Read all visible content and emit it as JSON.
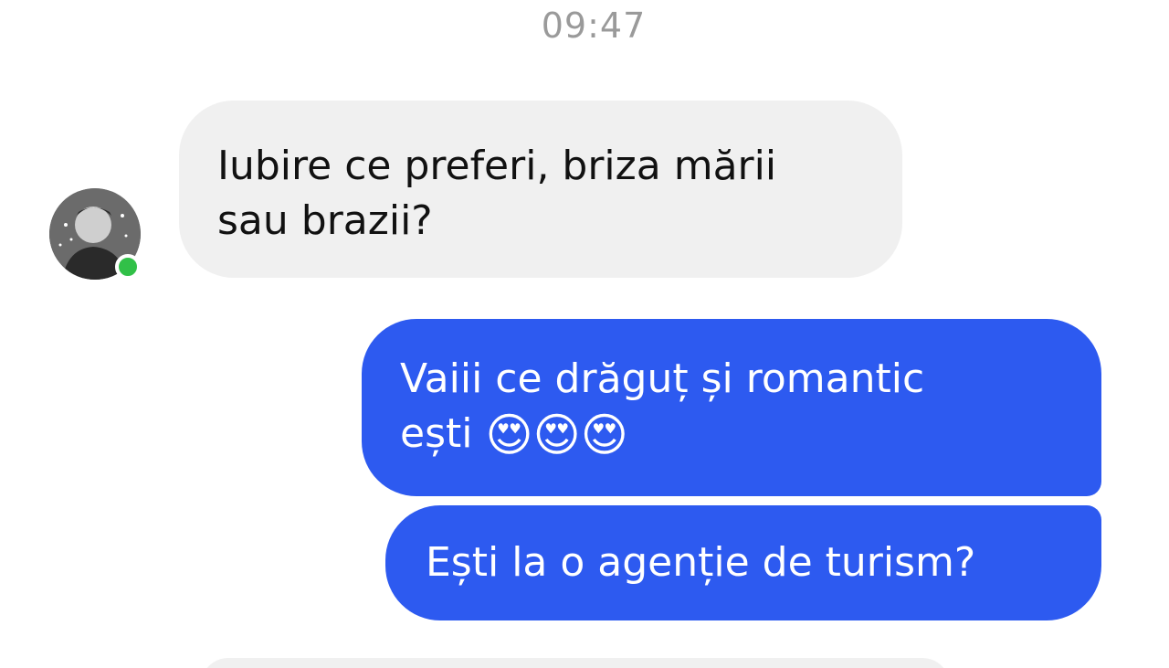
{
  "header": {
    "timestamp": "09:47"
  },
  "contact": {
    "avatar_icon": "person-avatar",
    "online_status_color": "#31c048"
  },
  "messages": [
    {
      "direction": "incoming",
      "lines": [
        "Iubire ce preferi, briza mării",
        "sau brazii?"
      ]
    },
    {
      "direction": "outgoing",
      "lines": [
        "Vaiii ce drăguț și romantic",
        "ești"
      ],
      "emoji": "😍😍😍"
    },
    {
      "direction": "outgoing",
      "lines": [
        "Ești la o agenție de turism?"
      ]
    }
  ],
  "colors": {
    "incoming_bubble": "#f0f0f0",
    "outgoing_bubble": "#2d5af0",
    "timestamp_text": "#9a9a9a"
  }
}
